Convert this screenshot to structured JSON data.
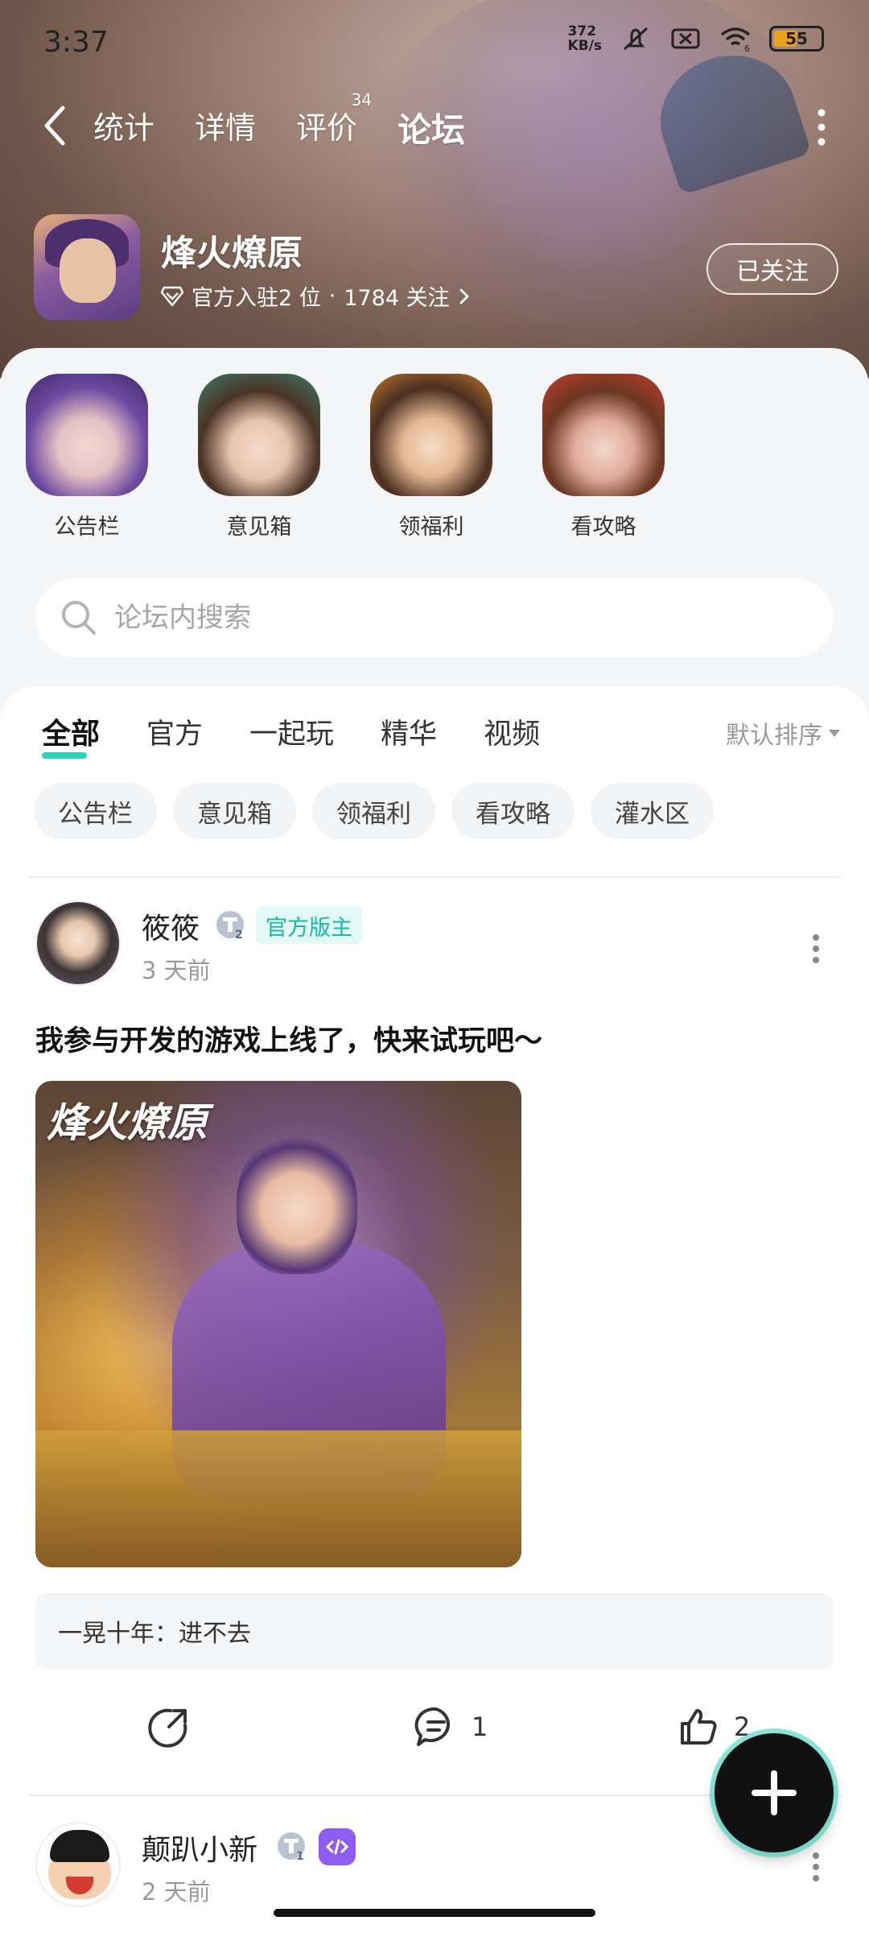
{
  "status_bar": {
    "time": "3:37",
    "netspeed_value": "372",
    "netspeed_unit": "KB/s",
    "wifi_label": "6",
    "battery": "55",
    "battery_level": 0.55,
    "icons": [
      "mute-icon",
      "sim-off-icon",
      "wifi-icon",
      "battery-icon"
    ]
  },
  "nav": {
    "tabs": [
      {
        "label": "统计"
      },
      {
        "label": "详情"
      },
      {
        "label": "评价",
        "badge": "34"
      },
      {
        "label": "论坛"
      }
    ],
    "active_tab": "论坛"
  },
  "game": {
    "name": "烽火燎原",
    "meta_rank": "官方入驻2 位",
    "meta_sep": "·",
    "meta_follows": "1784 关注",
    "follow_label": "已关注"
  },
  "channels": [
    {
      "label": "公告栏"
    },
    {
      "label": "意见箱"
    },
    {
      "label": "领福利"
    },
    {
      "label": "看攻略"
    }
  ],
  "search": {
    "placeholder": "论坛内搜索"
  },
  "filter_tabs": [
    {
      "label": "全部"
    },
    {
      "label": "官方"
    },
    {
      "label": "一起玩"
    },
    {
      "label": "精华"
    },
    {
      "label": "视频"
    }
  ],
  "sort_label": "默认排序",
  "chips": [
    {
      "label": "公告栏"
    },
    {
      "label": "意见箱"
    },
    {
      "label": "领福利"
    },
    {
      "label": "看攻略"
    },
    {
      "label": "灌水区"
    }
  ],
  "post1": {
    "author": "筱筱",
    "level": "2",
    "role": "官方版主",
    "time": "3 天前",
    "text": "我参与开发的游戏上线了，快来试玩吧～",
    "image_logo": "烽火燎原",
    "quote": "一晃十年：进不去",
    "comment_count": "1",
    "like_count": "2"
  },
  "post2": {
    "author": "颠趴小新",
    "level": "1",
    "time": "2 天前"
  },
  "colors": {
    "accent": "#2ed3bc",
    "role_badge_text": "#1ab8a3",
    "role_badge_bg": "#e1f8f4",
    "battery": "#e8a41e",
    "dev_badge": "#8f5cf2"
  }
}
